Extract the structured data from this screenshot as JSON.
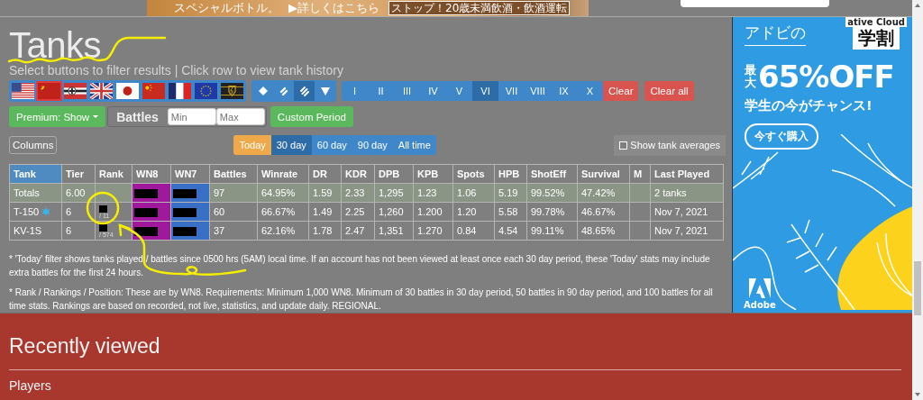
{
  "top_banner": {
    "texts": [
      "スペシャルボトル。",
      "▶詳しくはこちら",
      "ストップ！20歳未満飲酒・飲酒運転"
    ]
  },
  "title": "Tanks",
  "subtitle": "Select buttons to filter results | Click row to view tank history",
  "filters": {
    "nations": [
      {
        "kind": "usa",
        "selected": false
      },
      {
        "kind": "ussr",
        "selected": true
      },
      {
        "kind": "germany",
        "selected": false
      },
      {
        "kind": "uk",
        "selected": false
      },
      {
        "kind": "japan",
        "selected": false
      },
      {
        "kind": "china",
        "selected": false
      },
      {
        "kind": "france",
        "selected": false
      },
      {
        "kind": "europe",
        "selected": false
      },
      {
        "kind": "emblem",
        "selected": false
      }
    ],
    "types": [
      {
        "kind": "diamond",
        "selected": false
      },
      {
        "kind": "double_bar",
        "selected": false
      },
      {
        "kind": "triple_bar",
        "selected": true
      },
      {
        "kind": "triangle",
        "selected": false
      }
    ],
    "tiers": [
      {
        "label": "I",
        "selected": false
      },
      {
        "label": "II",
        "selected": false
      },
      {
        "label": "III",
        "selected": false
      },
      {
        "label": "IV",
        "selected": false
      },
      {
        "label": "V",
        "selected": false
      },
      {
        "label": "VI",
        "selected": true
      },
      {
        "label": "VII",
        "selected": false
      },
      {
        "label": "VIII",
        "selected": false
      },
      {
        "label": "IX",
        "selected": false
      },
      {
        "label": "X",
        "selected": false
      }
    ],
    "clear": "Clear",
    "clear_all": "Clear all",
    "premium": "Premium: Show",
    "battles_label": "Battles",
    "battles_min": {
      "placeholder": "Min"
    },
    "battles_max": {
      "placeholder": "Max"
    },
    "custom_period": "Custom Period"
  },
  "columns_button": "Columns",
  "periods": [
    {
      "label": "Today",
      "kind": "today",
      "selected": false
    },
    {
      "label": "30 day",
      "kind": "range",
      "selected": true
    },
    {
      "label": "60 day",
      "kind": "range",
      "selected": false
    },
    {
      "label": "90 day",
      "kind": "range",
      "selected": false
    },
    {
      "label": "All time",
      "kind": "range",
      "selected": false
    }
  ],
  "show_averages": {
    "label": "Show tank averages",
    "checked": false
  },
  "table": {
    "columns": [
      "Tank",
      "Tier",
      "Rank",
      "WN8",
      "WN7",
      "Battles",
      "Winrate",
      "DR",
      "KDR",
      "DPB",
      "KPB",
      "Spots",
      "HPB",
      "ShotEff",
      "Survival",
      "M",
      "Last Played"
    ],
    "rows": [
      {
        "kind": "totals",
        "cells": [
          {
            "text": "Totals",
            "badge": false
          },
          "6.00",
          {
            "redacted": false
          },
          {
            "color": "#a0199c",
            "redacted": true
          },
          {
            "color": "#3a6fc6",
            "redacted": true
          },
          "97",
          "64.95%",
          "1.59",
          "2.33",
          "1,295",
          "1.23",
          "1.06",
          "5.19",
          "99.52%",
          "47.42%",
          "",
          "2 tanks"
        ]
      },
      {
        "kind": "tank",
        "cells": [
          {
            "text": "T-150",
            "badge": true
          },
          "6",
          {
            "redacted": true,
            "total": "/ 11"
          },
          {
            "color": "#a0199c",
            "redacted": true
          },
          {
            "color": "#3a6fc6",
            "redacted": true
          },
          "60",
          "66.67%",
          "1.49",
          "2.25",
          "1,260",
          "1.200",
          "1.20",
          "5.58",
          "99.78%",
          "46.67%",
          "",
          "Nov 7, 2021"
        ]
      },
      {
        "kind": "tank",
        "cells": [
          {
            "text": "KV-1S",
            "badge": false
          },
          "6",
          {
            "redacted": true,
            "total": "/ 574"
          },
          {
            "color": "#a0199c",
            "redacted": true
          },
          {
            "color": "#3a6fc6",
            "redacted": true
          },
          "37",
          "62.16%",
          "1.78",
          "2.47",
          "1,351",
          "1.270",
          "0.84",
          "4.54",
          "99.11%",
          "48.65%",
          "",
          "Nov 7, 2021"
        ]
      }
    ]
  },
  "notes": [
    "* 'Today' filter shows tanks played / battles since 0500 hrs (5AM) local time. If an account has not been viewed at least once each 30 day period, these 'Today' stats may include extra battles for the first 24 hours.",
    "* Rank / Rankings / Position: These are by WN8. Requirements: Minimum 1,000 WN8. Minimum of 30 battles in 30 day period, 50 battles in 90 day period, and 100 battles for all time stats. Rankings are based on recorded, not live, statistics, and update daily. REGIONAL."
  ],
  "recently_viewed": {
    "title": "Recently viewed",
    "subtitle": "Players"
  },
  "side_ad": {
    "brand_line": "ative Cloud",
    "heading": "アドビの",
    "badge": "学割",
    "prefix": "最大",
    "offer": "65%OFF",
    "tagline": "学生の今がチャンス!",
    "button": "今すぐ購入",
    "logo": "Adobe"
  }
}
